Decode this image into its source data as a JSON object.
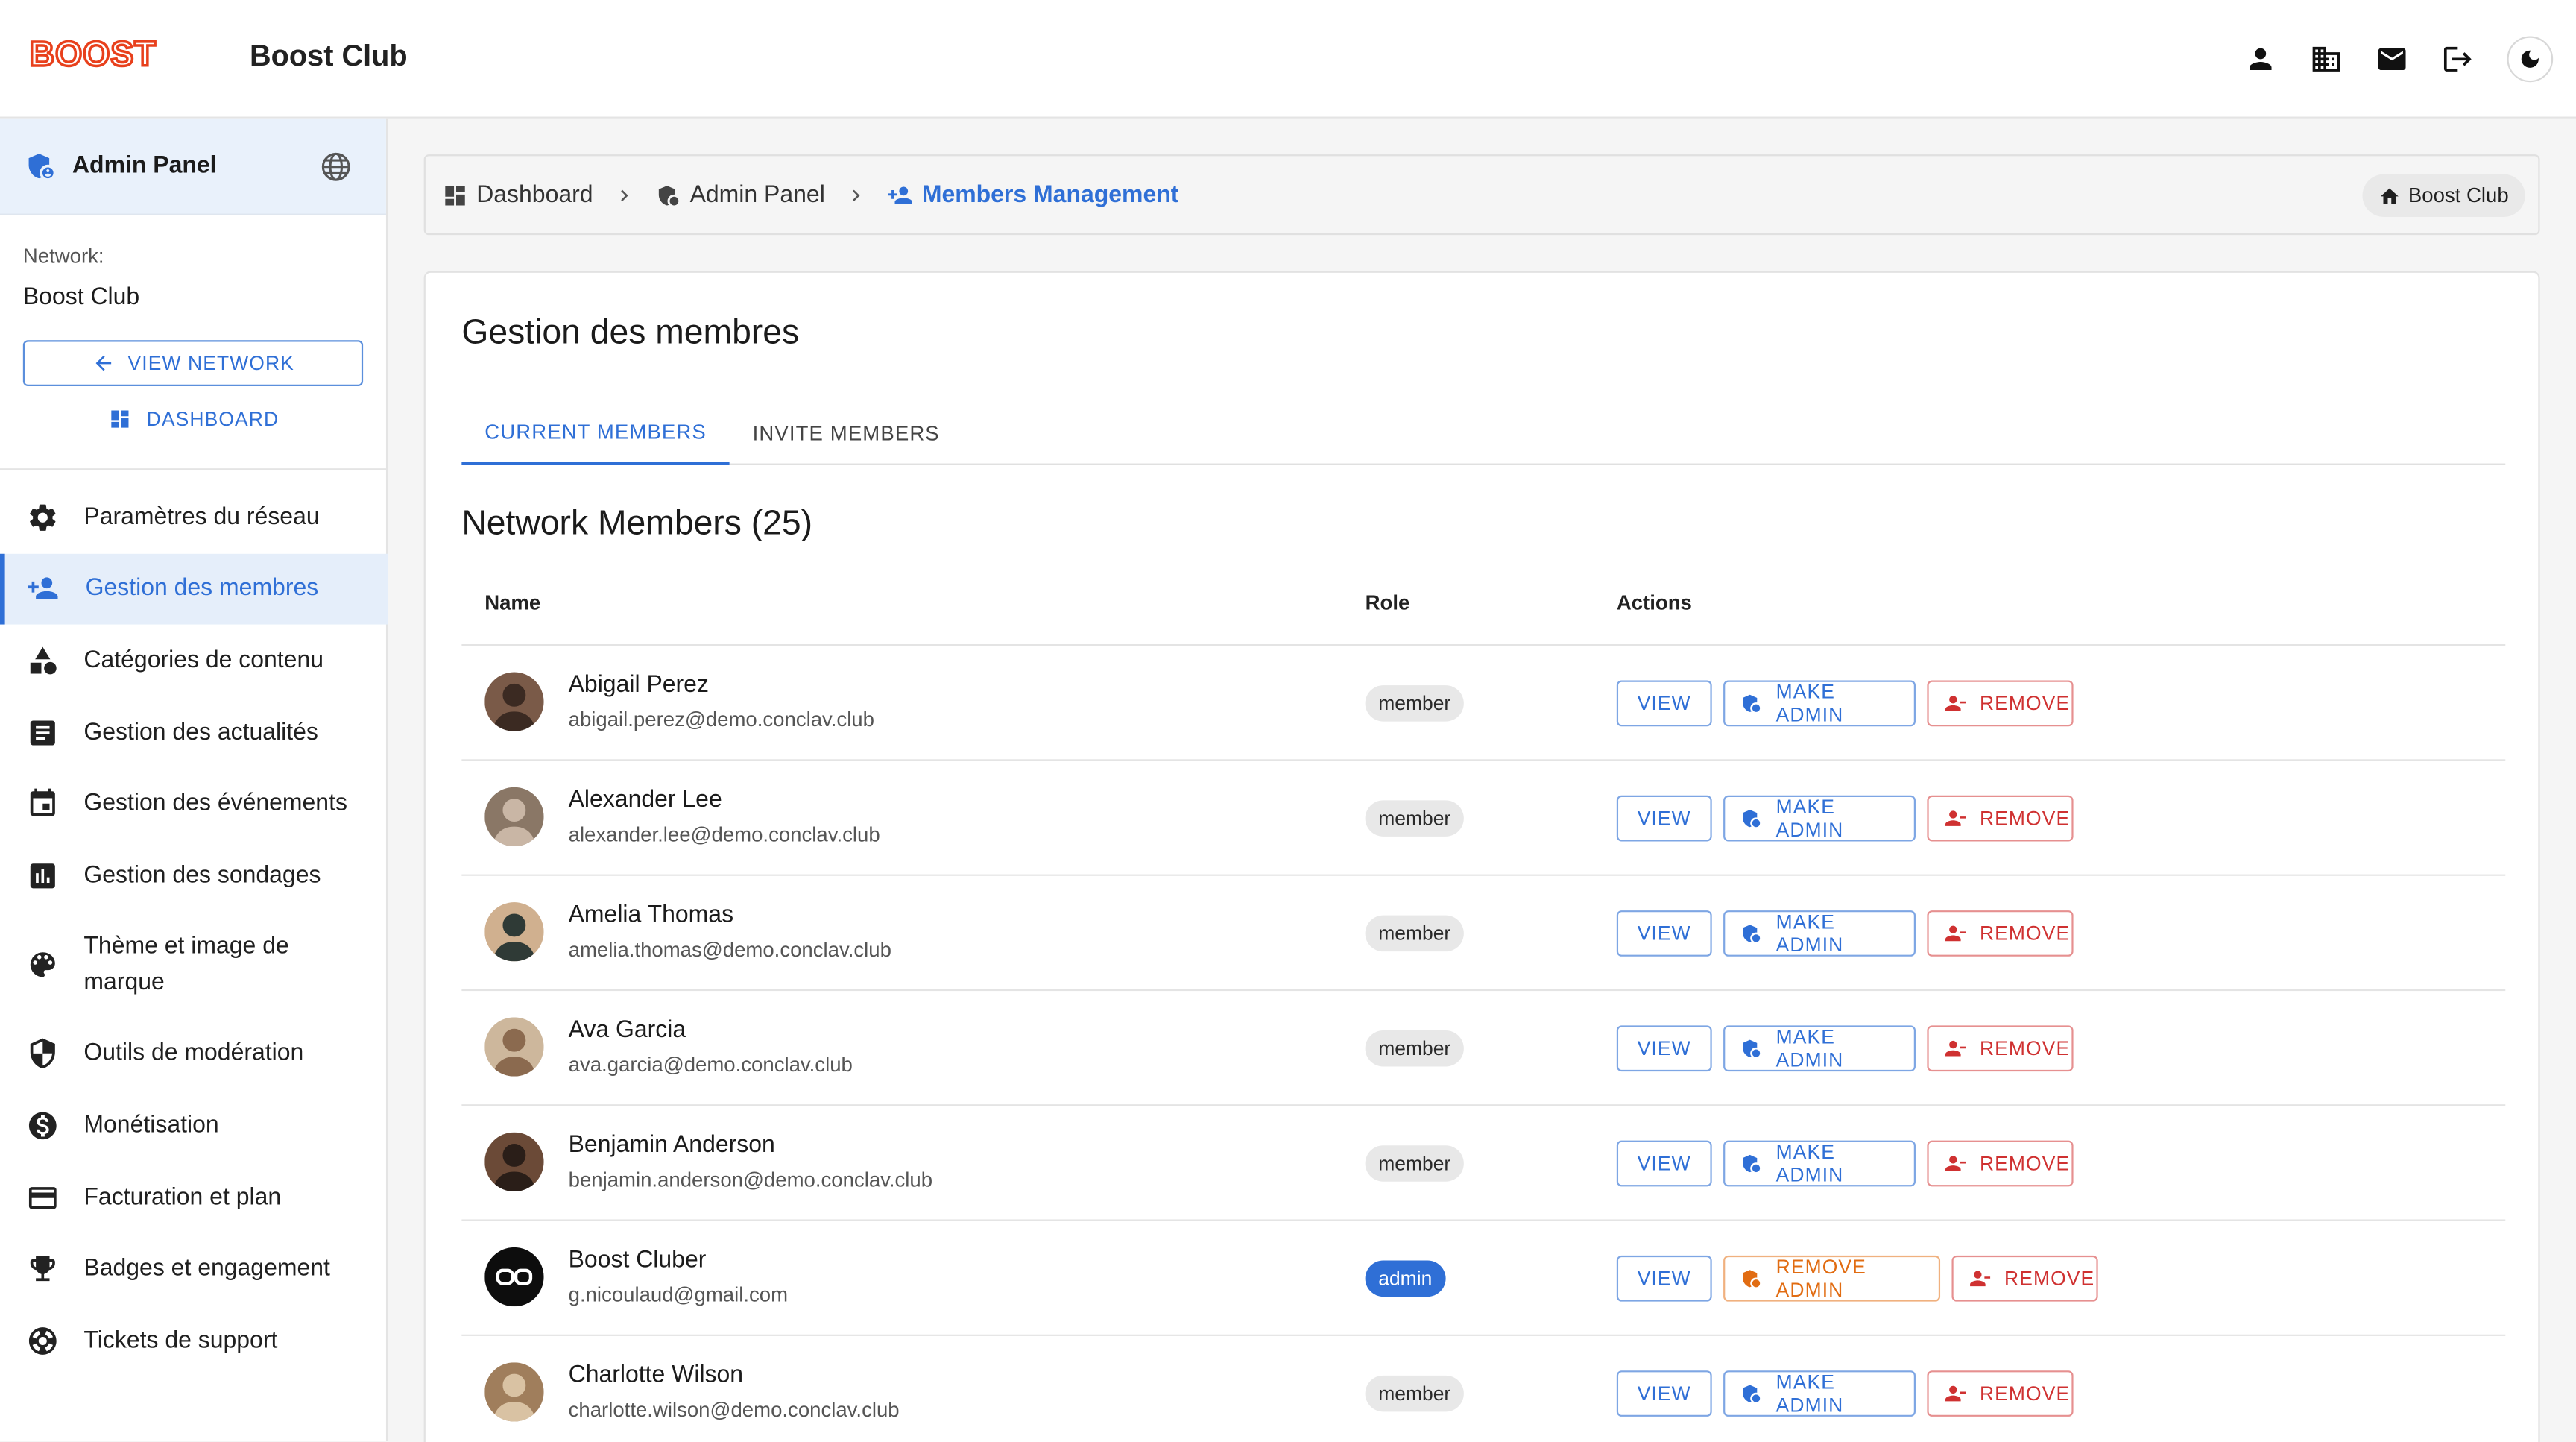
{
  "app": {
    "logo_text": "BOOST",
    "title": "Boost Club",
    "brand_color": "#e8401c",
    "accent": "#2f6fd6"
  },
  "topbar": {
    "icons": [
      "person-icon",
      "building-icon",
      "mail-icon",
      "logout-icon",
      "theme-toggle-icon"
    ]
  },
  "sidebar": {
    "header_title": "Admin Panel",
    "network_label": "Network:",
    "network_name": "Boost Club",
    "view_network": "VIEW NETWORK",
    "dashboard": "DASHBOARD",
    "items": [
      {
        "label": "Paramètres du réseau",
        "icon": "gear-icon"
      },
      {
        "label": "Gestion des membres",
        "icon": "person-add-icon",
        "active": true
      },
      {
        "label": "Catégories de contenu",
        "icon": "category-icon"
      },
      {
        "label": "Gestion des actualités",
        "icon": "article-icon"
      },
      {
        "label": "Gestion des événements",
        "icon": "calendar-icon"
      },
      {
        "label": "Gestion des sondages",
        "icon": "poll-icon"
      },
      {
        "label": "Thème et image de marque",
        "icon": "palette-icon"
      },
      {
        "label": "Outils de modération",
        "icon": "shield-icon"
      },
      {
        "label": "Monétisation",
        "icon": "money-icon"
      },
      {
        "label": "Facturation et plan",
        "icon": "credit-card-icon"
      },
      {
        "label": "Badges et engagement",
        "icon": "trophy-icon"
      },
      {
        "label": "Tickets de support",
        "icon": "support-icon"
      }
    ]
  },
  "breadcrumb": {
    "items": [
      "Dashboard",
      "Admin Panel",
      "Members Management"
    ],
    "club_chip": "Boost Club"
  },
  "main": {
    "title": "Gestion des membres",
    "tabs": [
      "CURRENT MEMBERS",
      "INVITE MEMBERS"
    ],
    "section_title": "Network Members (25)",
    "columns": [
      "Name",
      "Role",
      "Actions"
    ],
    "labels": {
      "view": "VIEW",
      "make_admin": "MAKE ADMIN",
      "remove_admin": "REMOVE ADMIN",
      "remove": "REMOVE"
    },
    "members": [
      {
        "name": "Abigail Perez",
        "email": "abigail.perez@demo.conclav.club",
        "role": "member"
      },
      {
        "name": "Alexander Lee",
        "email": "alexander.lee@demo.conclav.club",
        "role": "member"
      },
      {
        "name": "Amelia Thomas",
        "email": "amelia.thomas@demo.conclav.club",
        "role": "member"
      },
      {
        "name": "Ava Garcia",
        "email": "ava.garcia@demo.conclav.club",
        "role": "member"
      },
      {
        "name": "Benjamin Anderson",
        "email": "benjamin.anderson@demo.conclav.club",
        "role": "member"
      },
      {
        "name": "Boost Cluber",
        "email": "g.nicoulaud@gmail.com",
        "role": "admin"
      },
      {
        "name": "Charlotte Wilson",
        "email": "charlotte.wilson@demo.conclav.club",
        "role": "member"
      }
    ]
  }
}
